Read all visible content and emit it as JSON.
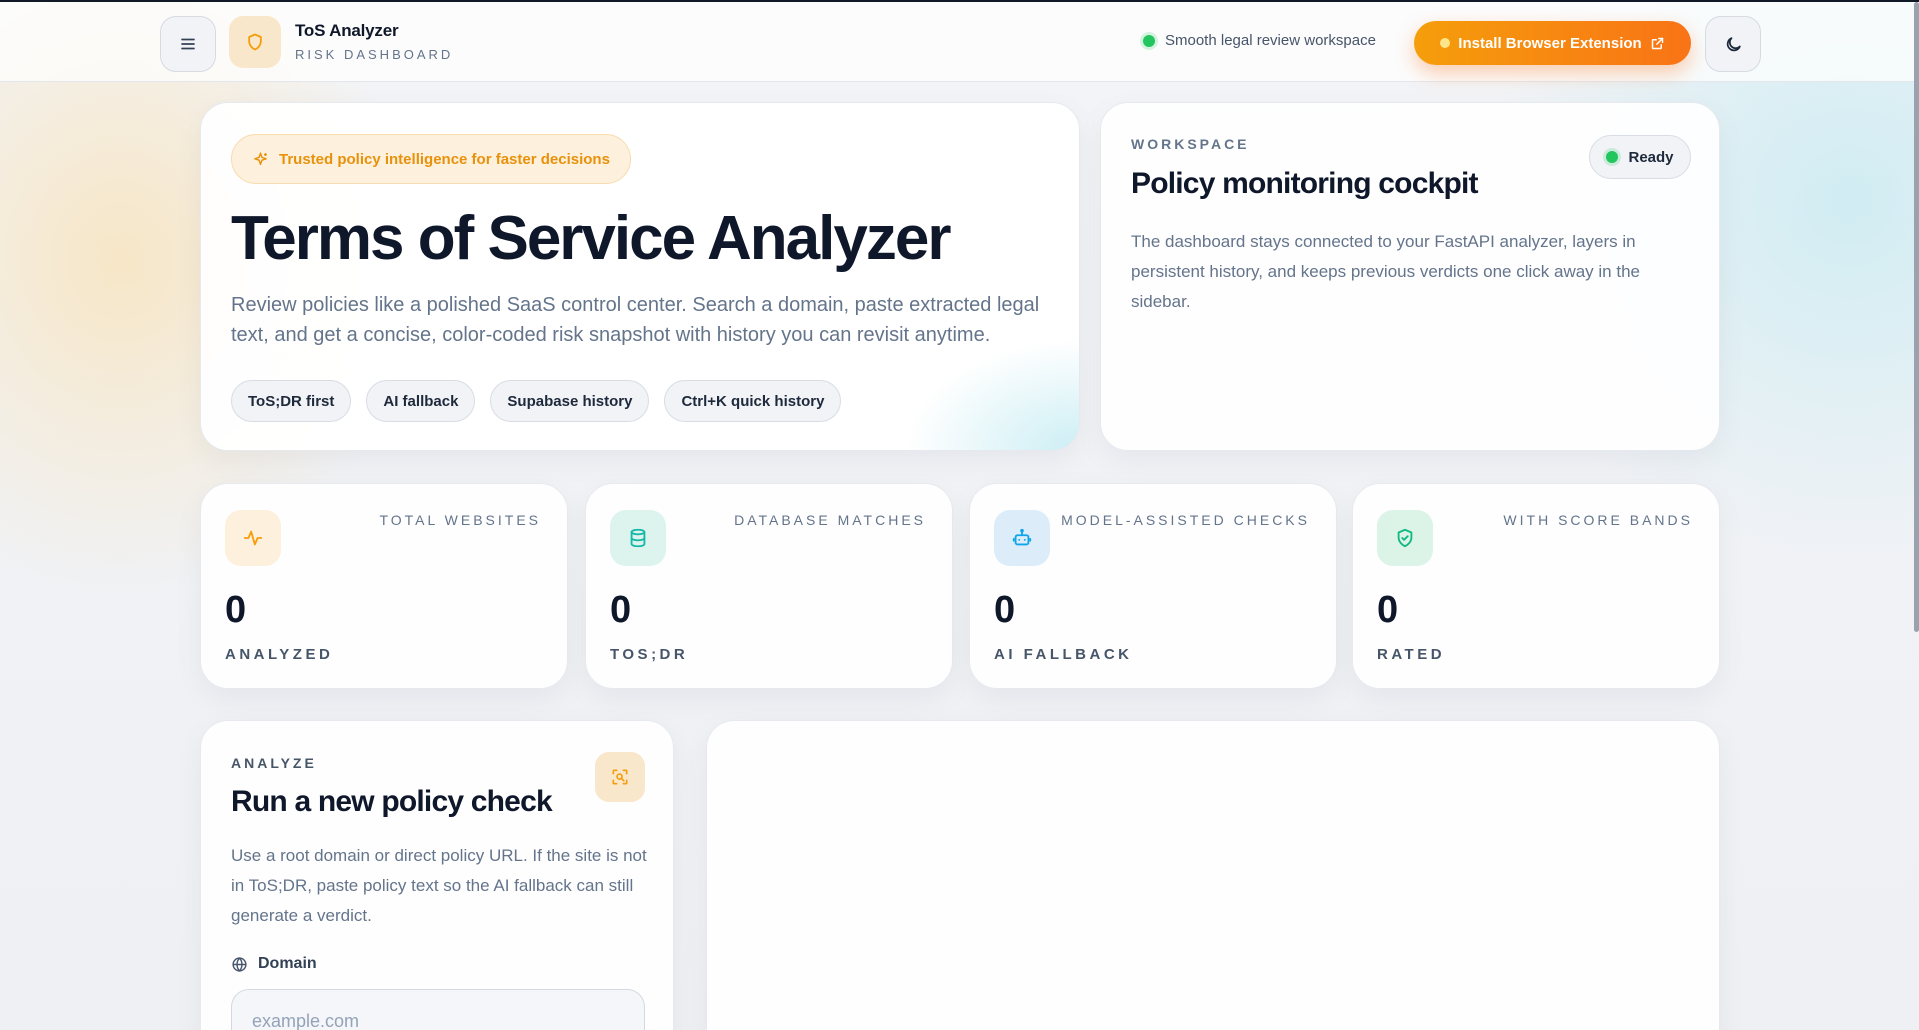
{
  "header": {
    "brand_title": "ToS Analyzer",
    "brand_subtitle": "RISK DASHBOARD",
    "status_text": "Smooth legal review workspace",
    "extension_button": "Install Browser Extension",
    "icons": {
      "menu": "menu-icon",
      "brand": "shield-icon",
      "theme": "moon-icon",
      "external": "external-link-icon"
    }
  },
  "hero": {
    "badge": "Trusted policy intelligence for faster decisions",
    "title": "Terms of Service Analyzer",
    "description": "Review policies like a polished SaaS control center. Search a domain, paste extracted legal text, and get a concise, color-coded risk snapshot with history you can revisit anytime.",
    "chips": [
      "ToS;DR first",
      "AI fallback",
      "Supabase history",
      "Ctrl+K quick history"
    ]
  },
  "workspace": {
    "label": "WORKSPACE",
    "title": "Policy monitoring cockpit",
    "status": "Ready",
    "description": "The dashboard stays connected to your FastAPI analyzer, layers in persistent history, and keeps previous verdicts one click away in the sidebar."
  },
  "stats": [
    {
      "label": "TOTAL WEBSITES",
      "value": "0",
      "sub": "ANALYZED",
      "icon": "activity-icon",
      "color": "#f59e0b"
    },
    {
      "label": "DATABASE MATCHES",
      "value": "0",
      "sub": "TOS;DR",
      "icon": "database-icon",
      "color": "#14b8a6"
    },
    {
      "label": "MODEL-ASSISTED CHECKS",
      "value": "0",
      "sub": "AI FALLBACK",
      "icon": "bot-icon",
      "color": "#0ea5e9"
    },
    {
      "label": "WITH SCORE BANDS",
      "value": "0",
      "sub": "RATED",
      "icon": "shield-check-icon",
      "color": "#10b981"
    }
  ],
  "analyze": {
    "label": "ANALYZE",
    "title": "Run a new policy check",
    "description": "Use a root domain or direct policy URL. If the site is not in ToS;DR, paste policy text so the AI fallback can still generate a verdict.",
    "domain_label": "Domain",
    "domain_placeholder": "example.com",
    "domain_value": ""
  },
  "colors": {
    "accent": "#f97316",
    "accent_light": "#f59e0b",
    "ready": "#22c55e"
  }
}
